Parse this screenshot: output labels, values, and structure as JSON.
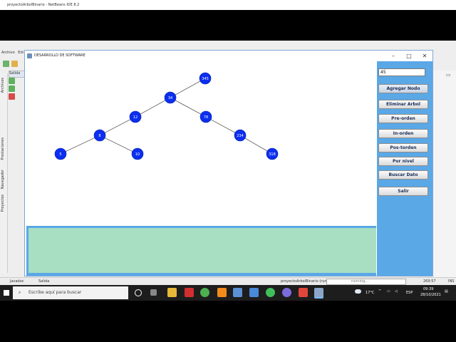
{
  "ide": {
    "title": "proyectoArbolBinario - NetBeans IDE 8.2",
    "menu": [
      "Archivo",
      "Edi"
    ],
    "left_tabs": [
      "Archivos",
      "Prestaciones",
      "Navegador",
      "Proyectos"
    ],
    "output_tab": "Salida",
    "bottom_tabs": [
      "Javadoc",
      "Salida"
    ],
    "status": {
      "project": "proyectoArbolBinario (run)",
      "running": "running...",
      "position": "269:57",
      "mode": "INS"
    }
  },
  "app": {
    "title": "DESARROLLO DE SOFTWARE",
    "input_value": "45",
    "buttons": [
      {
        "label": "Agregar Nodo"
      },
      {
        "label": "Eliminar Arbol"
      },
      {
        "label": "Pre-orden"
      },
      {
        "label": "In-orden"
      },
      {
        "label": "Pos-torden"
      },
      {
        "label": "Por nivel"
      },
      {
        "label": "Buscar Dato"
      },
      {
        "label": "Salir"
      }
    ],
    "tree": {
      "nodes": [
        {
          "id": "n345",
          "label": "345"
        },
        {
          "id": "n34",
          "label": "34"
        },
        {
          "id": "n12",
          "label": "12"
        },
        {
          "id": "n78",
          "label": "78"
        },
        {
          "id": "n8",
          "label": "8"
        },
        {
          "id": "n234",
          "label": "234"
        },
        {
          "id": "n5",
          "label": "5"
        },
        {
          "id": "n10",
          "label": "10"
        },
        {
          "id": "n318",
          "label": "318"
        }
      ],
      "edges": [
        [
          "n345",
          "n34"
        ],
        [
          "n34",
          "n12"
        ],
        [
          "n34",
          "n78"
        ],
        [
          "n12",
          "n8"
        ],
        [
          "n78",
          "n234"
        ],
        [
          "n8",
          "n5"
        ],
        [
          "n8",
          "n10"
        ],
        [
          "n234",
          "n318"
        ]
      ],
      "colors": {
        "node": "#0b2ef0",
        "text": "#ffffff"
      }
    }
  },
  "taskbar": {
    "search_placeholder": "Escribe aquí para buscar",
    "weather": "17°C",
    "language": "ESP",
    "time": "09:39",
    "date": "28/10/2021"
  }
}
